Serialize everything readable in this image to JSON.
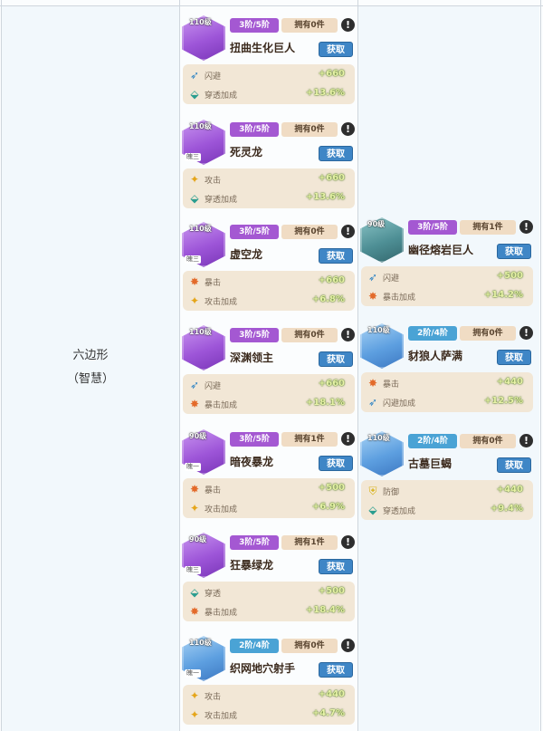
{
  "row_label": {
    "line1": "六边形",
    "line2": "（智慧）"
  },
  "colors": {
    "purple_stage": "#a458d2",
    "blue_stage": "#4aa3d5",
    "stat_panel": "#f2e7d6",
    "get_button": "#3f86c6"
  },
  "column1": [
    {
      "level": "110级",
      "stage": "3阶/5阶",
      "owned": "拥有0件",
      "warn": "!",
      "name": "扭曲生化巨人",
      "button": "获取",
      "tag": "",
      "portrait": "purple",
      "stats": [
        {
          "icon": "dodge-icon",
          "glyph": "➶",
          "name": "闪避",
          "value": "+660"
        },
        {
          "icon": "pierce-icon",
          "glyph": "⬙",
          "name": "穿透加成",
          "value": "+13.6%"
        }
      ]
    },
    {
      "level": "110级",
      "stage": "3阶/5阶",
      "owned": "拥有0件",
      "warn": "!",
      "name": "死灵龙",
      "button": "获取",
      "tag": "魄三",
      "portrait": "purple",
      "stats": [
        {
          "icon": "attack-icon",
          "glyph": "✦",
          "name": "攻击",
          "value": "+660"
        },
        {
          "icon": "pierce-icon",
          "glyph": "⬙",
          "name": "穿透加成",
          "value": "+13.6%"
        }
      ]
    },
    {
      "level": "110级",
      "stage": "3阶/5阶",
      "owned": "拥有0件",
      "warn": "!",
      "name": "虚空龙",
      "button": "获取",
      "tag": "魄三",
      "portrait": "purple",
      "stats": [
        {
          "icon": "crit-icon",
          "glyph": "✸",
          "name": "暴击",
          "value": "+660"
        },
        {
          "icon": "attack-icon",
          "glyph": "✦",
          "name": "攻击加成",
          "value": "+6.8%"
        }
      ]
    },
    {
      "level": "110级",
      "stage": "3阶/5阶",
      "owned": "拥有0件",
      "warn": "!",
      "name": "深渊领主",
      "button": "获取",
      "tag": "",
      "portrait": "purple",
      "stats": [
        {
          "icon": "dodge-icon",
          "glyph": "➶",
          "name": "闪避",
          "value": "+660"
        },
        {
          "icon": "crit-icon",
          "glyph": "✸",
          "name": "暴击加成",
          "value": "+18.1%"
        }
      ]
    },
    {
      "level": "90级",
      "stage": "3阶/5阶",
      "owned": "拥有1件",
      "warn": "!",
      "name": "暗夜暴龙",
      "button": "获取",
      "tag": "魄一",
      "portrait": "purple",
      "stats": [
        {
          "icon": "crit-icon",
          "glyph": "✸",
          "name": "暴击",
          "value": "+500"
        },
        {
          "icon": "attack-icon",
          "glyph": "✦",
          "name": "攻击加成",
          "value": "+6.9%"
        }
      ]
    },
    {
      "level": "90级",
      "stage": "3阶/5阶",
      "owned": "拥有1件",
      "warn": "!",
      "name": "狂暴绿龙",
      "button": "获取",
      "tag": "魄三",
      "portrait": "purple",
      "stats": [
        {
          "icon": "pierce-icon",
          "glyph": "⬙",
          "name": "穿透",
          "value": "+500"
        },
        {
          "icon": "crit-icon",
          "glyph": "✸",
          "name": "暴击加成",
          "value": "+18.4%"
        }
      ]
    },
    {
      "level": "110级",
      "stage": "2阶/4阶",
      "owned": "拥有0件",
      "warn": "!",
      "name": "织网地穴射手",
      "button": "获取",
      "tag": "魄一",
      "portrait": "blue",
      "stats": [
        {
          "icon": "attack-icon",
          "glyph": "✦",
          "name": "攻击",
          "value": "+440"
        },
        {
          "icon": "attack-icon",
          "glyph": "✦",
          "name": "攻击加成",
          "value": "+4.7%"
        }
      ]
    }
  ],
  "column2": [
    {
      "level": "90级",
      "stage": "3阶/5阶",
      "owned": "拥有1件",
      "warn": "!",
      "name": "幽径熔岩巨人",
      "button": "获取",
      "tag": "",
      "portrait": "teal",
      "stats": [
        {
          "icon": "dodge-icon",
          "glyph": "➶",
          "name": "闪避",
          "value": "+500"
        },
        {
          "icon": "crit-icon",
          "glyph": "✸",
          "name": "暴击加成",
          "value": "+14.2%"
        }
      ]
    },
    {
      "level": "110级",
      "stage": "2阶/4阶",
      "owned": "拥有0件",
      "warn": "!",
      "name": "豺狼人萨满",
      "button": "获取",
      "tag": "",
      "portrait": "blue",
      "stats": [
        {
          "icon": "crit-icon",
          "glyph": "✸",
          "name": "暴击",
          "value": "+440"
        },
        {
          "icon": "dodge-icon",
          "glyph": "➶",
          "name": "闪避加成",
          "value": "+12.5%"
        }
      ]
    },
    {
      "level": "110级",
      "stage": "2阶/4阶",
      "owned": "拥有0件",
      "warn": "!",
      "name": "古墓巨蝎",
      "button": "获取",
      "tag": "",
      "portrait": "blue",
      "stats": [
        {
          "icon": "defense-icon",
          "glyph": "⛨",
          "name": "防御",
          "value": "+440"
        },
        {
          "icon": "pierce-icon",
          "glyph": "⬙",
          "name": "穿透加成",
          "value": "+9.4%"
        }
      ]
    }
  ]
}
